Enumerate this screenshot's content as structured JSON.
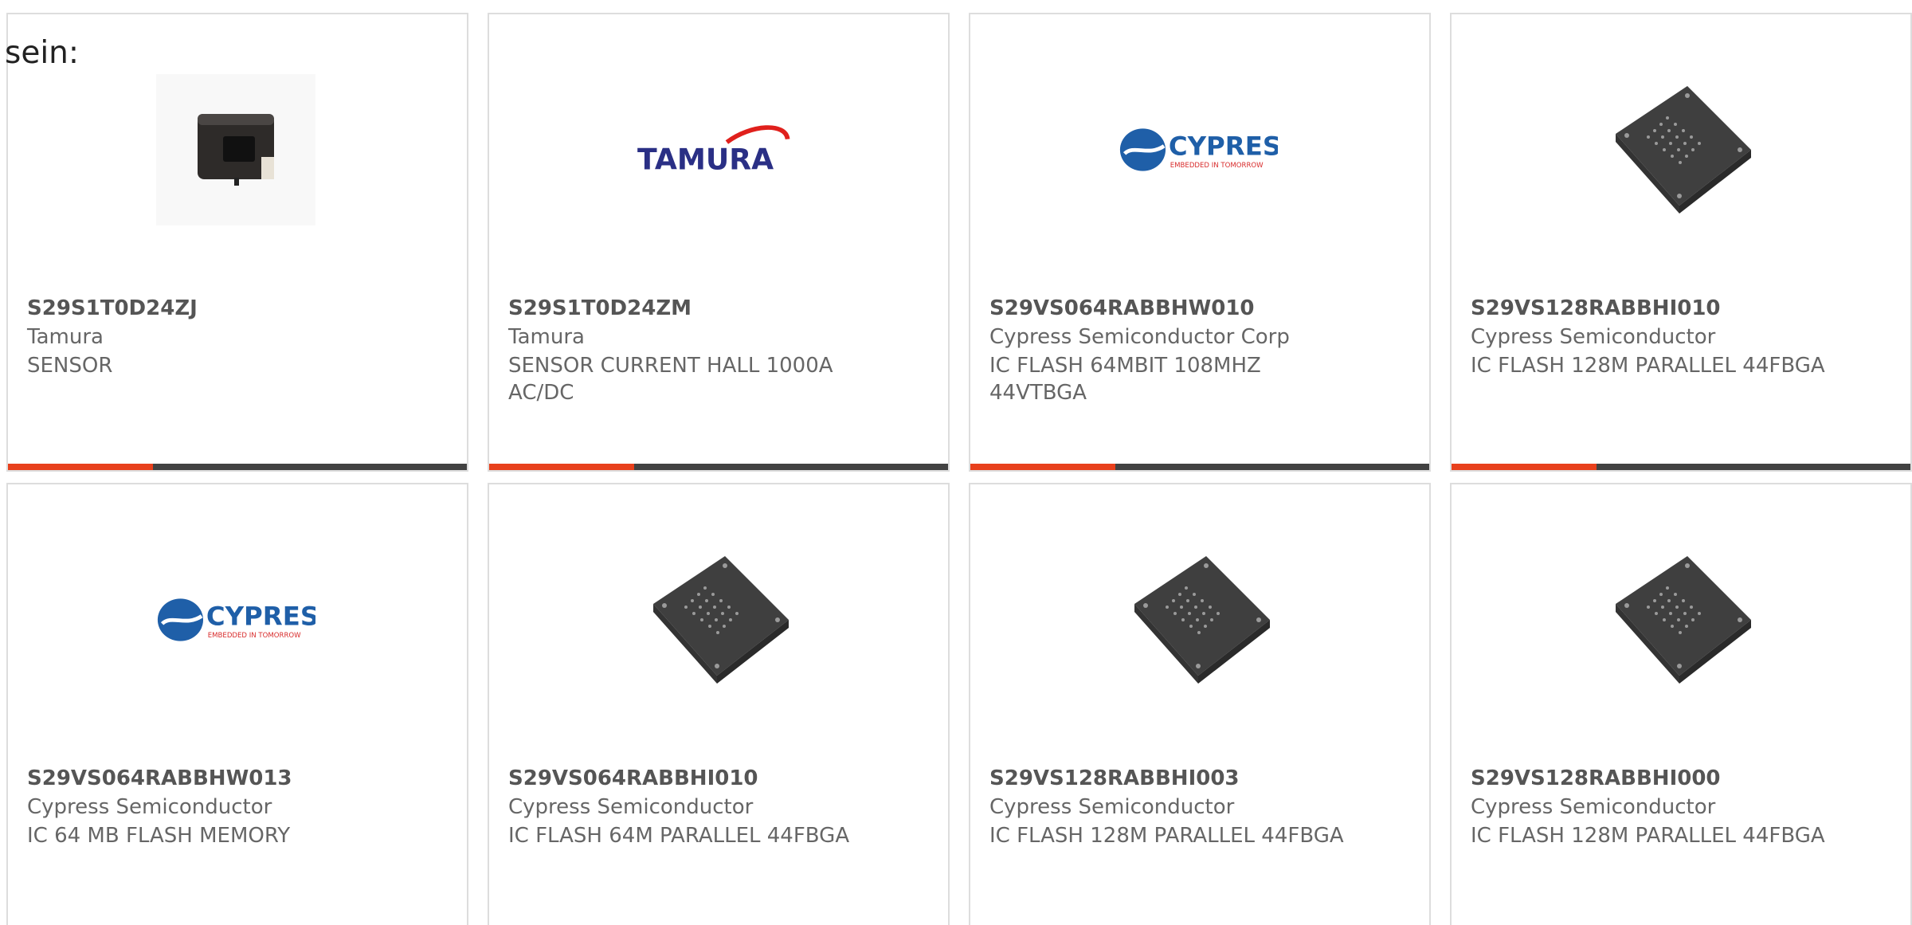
{
  "heading": "sein:",
  "products": [
    {
      "part_number": "S29S1T0D24ZJ",
      "manufacturer": "Tamura",
      "description": "SENSOR",
      "image": "current-sensor-photo"
    },
    {
      "part_number": "S29S1T0D24ZM",
      "manufacturer": "Tamura",
      "description": "SENSOR CURRENT HALL 1000A AC/DC",
      "image": "tamura-logo",
      "logo_text": "TAMURA"
    },
    {
      "part_number": "S29VS064RABBHW010",
      "manufacturer": "Cypress Semiconductor Corp",
      "description": "IC FLASH 64MBIT 108MHZ 44VTBGA",
      "image": "cypress-logo",
      "logo_text": "CYPRESS",
      "logo_tagline": "EMBEDDED IN TOMORROW"
    },
    {
      "part_number": "S29VS128RABBHI010",
      "manufacturer": "Cypress Semiconductor",
      "description": "IC FLASH 128M PARALLEL 44FBGA",
      "image": "bga-chip-photo"
    },
    {
      "part_number": "S29VS064RABBHW013",
      "manufacturer": "Cypress Semiconductor",
      "description": "IC 64 MB FLASH MEMORY",
      "image": "cypress-logo",
      "logo_text": "CYPRESS",
      "logo_tagline": "EMBEDDED IN TOMORROW"
    },
    {
      "part_number": "S29VS064RABBHI010",
      "manufacturer": "Cypress Semiconductor",
      "description": "IC FLASH 64M PARALLEL 44FBGA",
      "image": "bga-chip-photo"
    },
    {
      "part_number": "S29VS128RABBHI003",
      "manufacturer": "Cypress Semiconductor",
      "description": "IC FLASH 128M PARALLEL 44FBGA",
      "image": "bga-chip-photo"
    },
    {
      "part_number": "S29VS128RABBHI000",
      "manufacturer": "Cypress Semiconductor",
      "description": "IC FLASH 128M PARALLEL 44FBGA",
      "image": "bga-chip-photo"
    }
  ],
  "colors": {
    "accent": "#e8401c",
    "bar": "#424242",
    "tamura_blue": "#2a2f85",
    "tamura_red": "#e0201c",
    "cypress_blue": "#1f5fa8",
    "cypress_red": "#d82b2b",
    "chip": "#3f3f3f"
  }
}
